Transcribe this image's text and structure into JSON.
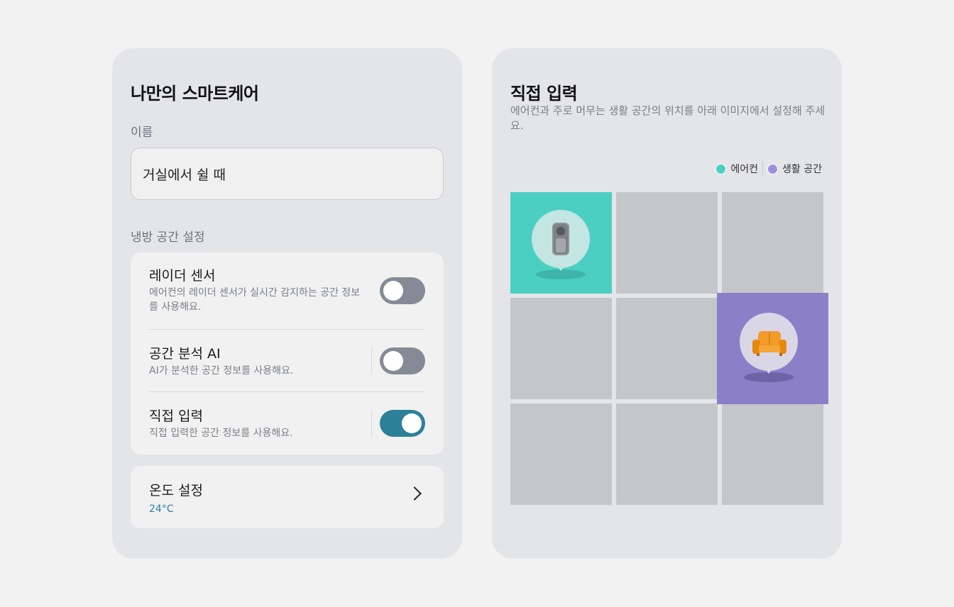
{
  "left_panel": {
    "title": "나만의 스마트케어",
    "name_label": "이름",
    "name_value": "거실에서 쉴 때",
    "cooling_label": "냉방 공간 설정",
    "settings": [
      {
        "title": "레이더 센서",
        "desc": "에어컨의 레이더 센서가 실시간 감지하는 공간 정보를 사용해요.",
        "enabled": false
      },
      {
        "title": "공간 분석 AI",
        "desc": "AI가 분석한 공간 정보를 사용해요.",
        "enabled": false
      },
      {
        "title": "직접 입력",
        "desc": "직접 입력한 공간 정보를 사용해요.",
        "enabled": true
      }
    ],
    "temperature": {
      "title": "온도 설정",
      "value": "24°C"
    }
  },
  "right_panel": {
    "title": "직접 입력",
    "subtitle": "에어컨과 주로 머무는 생활 공간의 위치를 아래 이미지에서  설정해 주세요.",
    "legend": [
      {
        "label": "에어컨",
        "color": "#4ccfc3"
      },
      {
        "label": "생활 공간",
        "color": "#9d8fdd"
      }
    ],
    "grid": {
      "rows": 3,
      "cols": 3,
      "ac_cell": [
        0,
        0
      ],
      "living_cell": [
        1,
        2
      ]
    },
    "icons": {
      "ac": "air-conditioner-icon",
      "living": "sofa-icon"
    }
  },
  "colors": {
    "toggle_on": "#2c8199",
    "toggle_off": "#858a96",
    "ac": "#4ccfc3",
    "living": "#8b7fc8",
    "cell": "#c4c6c9"
  }
}
